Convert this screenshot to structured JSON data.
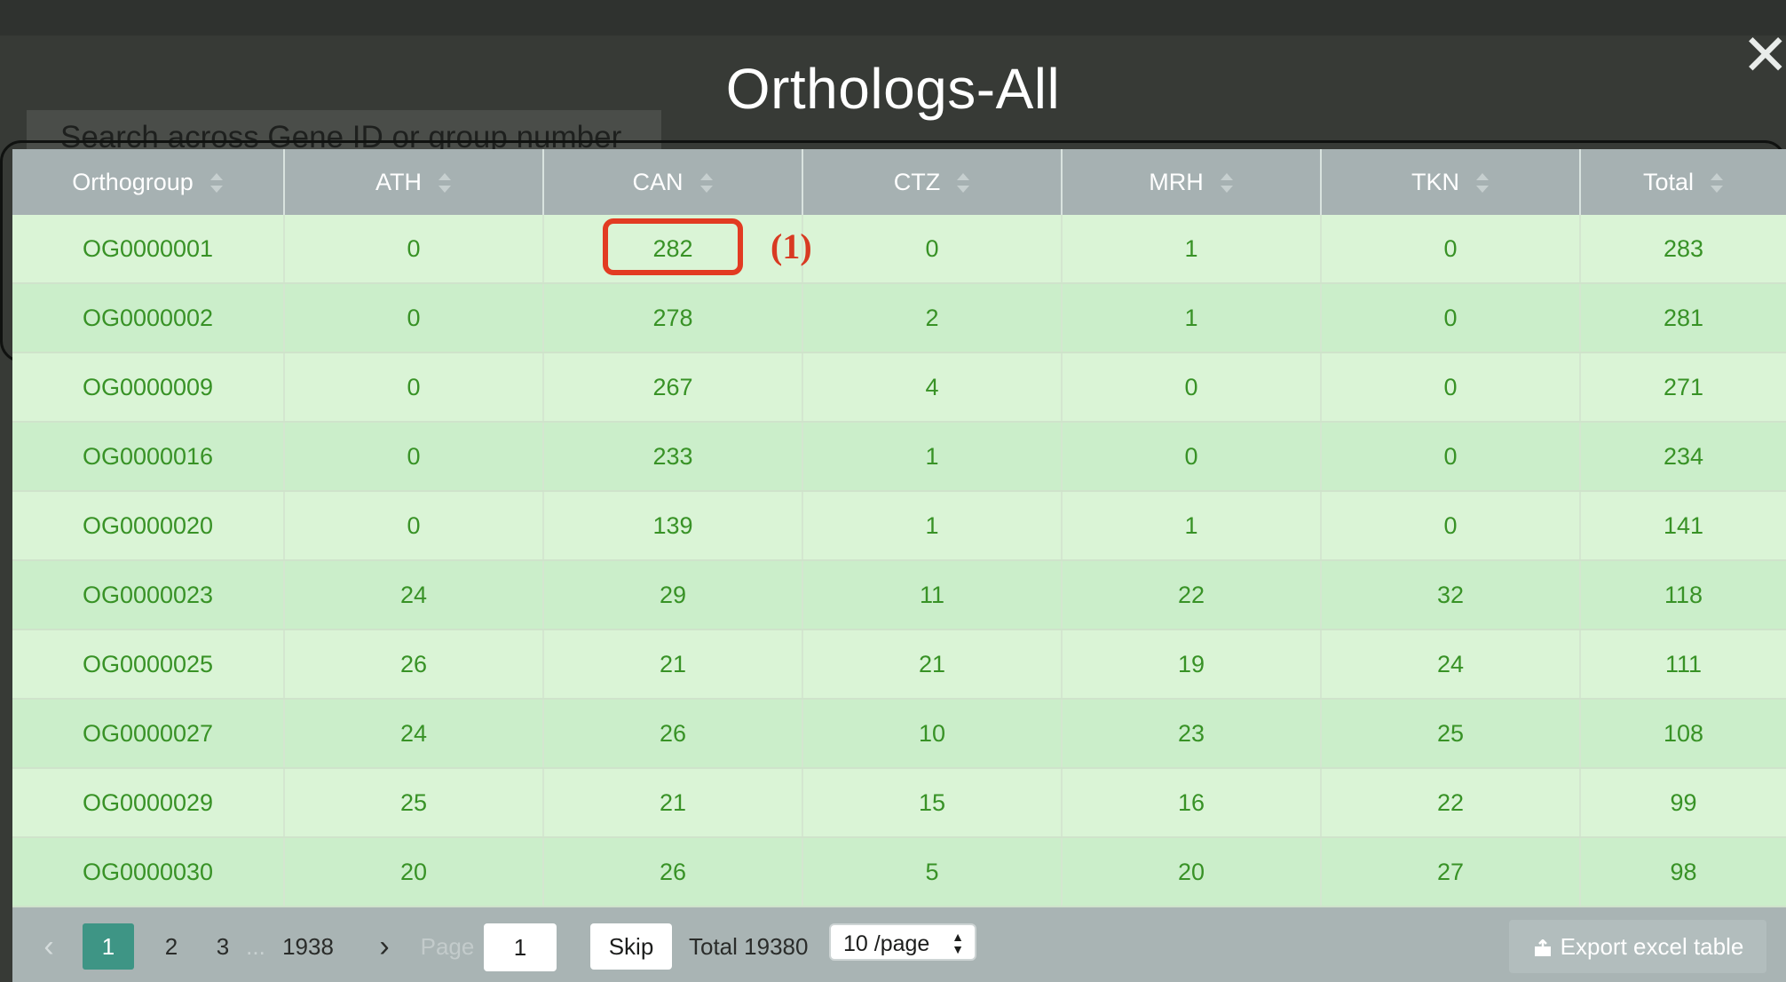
{
  "modal": {
    "title": "Orthologs-All",
    "close_label": "✕"
  },
  "background": {
    "search_placeholder": "Search across Gene ID or group number"
  },
  "table": {
    "columns": [
      "Orthogroup",
      "ATH",
      "CAN",
      "CTZ",
      "MRH",
      "TKN",
      "Total"
    ],
    "rows": [
      [
        "OG0000001",
        "0",
        "282",
        "0",
        "1",
        "0",
        "283"
      ],
      [
        "OG0000002",
        "0",
        "278",
        "2",
        "1",
        "0",
        "281"
      ],
      [
        "OG0000009",
        "0",
        "267",
        "4",
        "0",
        "0",
        "271"
      ],
      [
        "OG0000016",
        "0",
        "233",
        "1",
        "0",
        "0",
        "234"
      ],
      [
        "OG0000020",
        "0",
        "139",
        "1",
        "1",
        "0",
        "141"
      ],
      [
        "OG0000023",
        "24",
        "29",
        "11",
        "22",
        "32",
        "118"
      ],
      [
        "OG0000025",
        "26",
        "21",
        "21",
        "19",
        "24",
        "111"
      ],
      [
        "OG0000027",
        "24",
        "26",
        "10",
        "23",
        "25",
        "108"
      ],
      [
        "OG0000029",
        "25",
        "21",
        "15",
        "16",
        "22",
        "99"
      ],
      [
        "OG0000030",
        "20",
        "26",
        "5",
        "20",
        "27",
        "98"
      ]
    ]
  },
  "annotation": {
    "label": "(1)",
    "color": "#e23b22"
  },
  "pagination": {
    "prev_label": "‹",
    "pages": [
      "1",
      "2",
      "3"
    ],
    "ellipsis": "...",
    "last_page": "1938",
    "next_label": "›",
    "page_label": "Page",
    "page_input_value": "1",
    "skip_label": "Skip",
    "total_label": "Total 19380",
    "page_size": "10 /page",
    "export_label": "Export excel table"
  },
  "colors": {
    "header_bg": "#a6b1b2",
    "row_odd": "#daf4d6",
    "row_even": "#cbeeca",
    "cell_text": "#389226",
    "active_page": "#3e9585"
  }
}
